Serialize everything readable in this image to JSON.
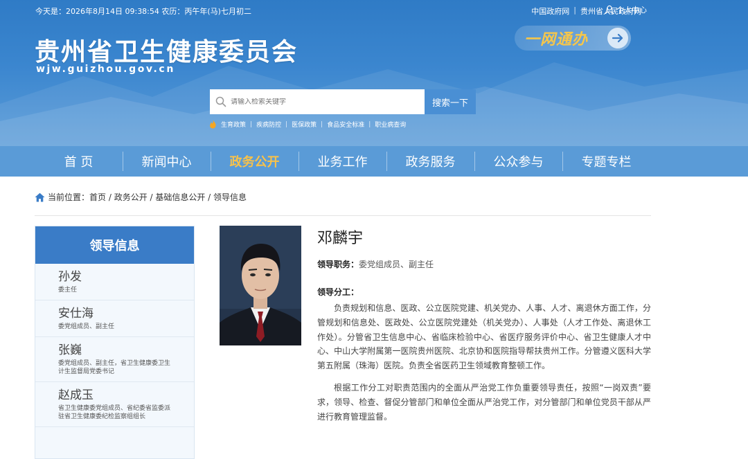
{
  "header": {
    "date_line": "今天是：2026年8月14日 09:38:54 农历：丙午年(马)七月初二",
    "top_links": [
      "中国政府网",
      "贵州省人民政府网"
    ],
    "user_center": "个人中心",
    "site_title": "贵州省卫生健康委员会",
    "site_domain": "wjw.guizhou.gov.cn",
    "yiwangtongban": "一网通办",
    "search": {
      "placeholder": "请输入检索关键字",
      "button": "搜索一下"
    },
    "hot_words": [
      "生育政策",
      "疾病防控",
      "医保政策",
      "食品安全标准",
      "职业病查询"
    ]
  },
  "nav": {
    "items": [
      "首 页",
      "新闻中心",
      "政务公开",
      "业务工作",
      "政务服务",
      "公众参与",
      "专题专栏"
    ],
    "active_index": 2
  },
  "breadcrumb": {
    "prefix": "当前位置：",
    "path": "首页 / 政务公开 / 基础信息公开 / 领导信息"
  },
  "sidebar": {
    "title": "领导信息",
    "leaders": [
      {
        "name": "孙发",
        "role": "委主任"
      },
      {
        "name": "安仕海",
        "role": "委党组成员、副主任"
      },
      {
        "name": "张巍",
        "role": "委党组成员、副主任，省卫生健康委卫生计生监督局党委书记"
      },
      {
        "name": "赵成玉",
        "role": "省卫生健康委党组成员、省纪委省监委派驻省卫生健康委纪检监察组组长"
      }
    ]
  },
  "profile": {
    "name": "邓麟宇",
    "position_label": "领导职务：",
    "position": "委党组成员、副主任",
    "duty_label": "领导分工：",
    "duty_paragraphs": [
      "负责规划和信息、医政、公立医院党建、机关党办、人事、人才、离退休方面工作，分管规划和信息处、医政处、公立医院党建处（机关党办）、人事处（人才工作处、离退休工作处）。分管省卫生信息中心、省临床检验中心、省医疗服务评价中心、省卫生健康人才中心、中山大学附属第一医院贵州医院、北京协和医院指导帮扶贵州工作。分管遵义医科大学第五附属（珠海）医院。负责全省医药卫生领域教育整顿工作。",
      "根据工作分工对职责范围内的全面从严治党工作负重要领导责任，按照“一岗双责”要求，领导、检查、督促分管部门和单位全面从严治党工作，对分管部门和单位党员干部从严进行教育管理监督。"
    ]
  },
  "colors": {
    "header_blue": "#2f7bc6",
    "nav_blue": "#5a9bd7",
    "active_gold": "#f8c24a",
    "sidebar_title_blue": "#3a7cc7"
  }
}
